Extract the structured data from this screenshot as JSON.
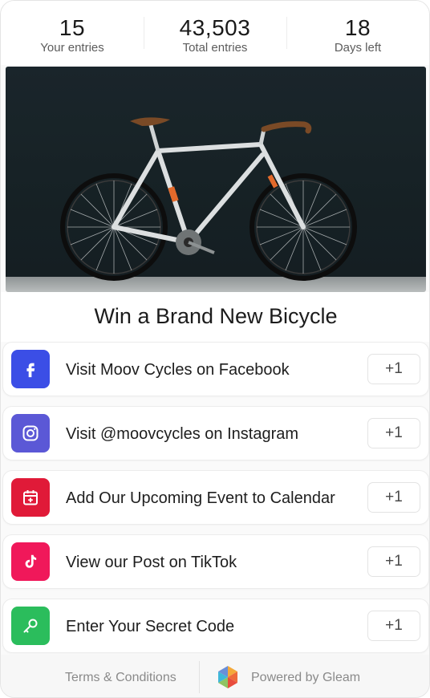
{
  "stats": [
    {
      "value": "15",
      "label": "Your entries"
    },
    {
      "value": "43,503",
      "label": "Total entries"
    },
    {
      "value": "18",
      "label": "Days left"
    }
  ],
  "hero": {
    "image_icon": "bicycle-photo"
  },
  "title": "Win a Brand New Bicycle",
  "entries": [
    {
      "label": "Visit Moov Cycles on Facebook",
      "points": "+1",
      "icon": "facebook-icon",
      "color": "#3b4ee6"
    },
    {
      "label": "Visit @moovcycles on Instagram",
      "points": "+1",
      "icon": "instagram-icon",
      "color": "#5b58d6"
    },
    {
      "label": "Add Our Upcoming Event to Calendar",
      "points": "+1",
      "icon": "calendar-icon",
      "color": "#e01a38"
    },
    {
      "label": "View our Post on TikTok",
      "points": "+1",
      "icon": "tiktok-icon",
      "color": "#f0185a"
    },
    {
      "label": "Enter Your Secret Code",
      "points": "+1",
      "icon": "key-icon",
      "color": "#2bbd5c"
    }
  ],
  "footer": {
    "terms": "Terms & Conditions",
    "powered": "Powered by Gleam",
    "logo_icon": "gleam-logo"
  }
}
